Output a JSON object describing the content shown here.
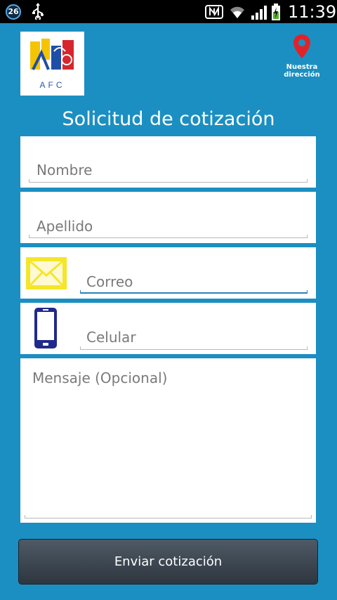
{
  "status_bar": {
    "notification_count": "26",
    "time": "11:39"
  },
  "header": {
    "logo_text": "AFC",
    "location_label_line1": "Nuestra",
    "location_label_line2": "dirección"
  },
  "form": {
    "title": "Solicitud de cotización",
    "first_name_placeholder": "Nombre",
    "last_name_placeholder": "Apellido",
    "email_placeholder": "Correo",
    "phone_placeholder": "Celular",
    "message_placeholder": "Mensaje (Opcional)",
    "submit_label": "Enviar cotización"
  },
  "colors": {
    "background": "#1b8fc1",
    "status_bar": "#000000",
    "field_background": "#ffffff",
    "button_background": "#3a4550",
    "mail_icon": "#f5e629",
    "phone_icon": "#1f2a8c",
    "pin": "#e0232b"
  },
  "icons": {
    "notification": "badge-icon",
    "usb": "usb-icon",
    "nfc": "nfc-icon",
    "wifi": "wifi-icon",
    "signal": "signal-icon",
    "battery": "battery-charging-icon",
    "location": "location-pin-icon",
    "email": "envelope-icon",
    "phone": "mobile-phone-icon"
  }
}
